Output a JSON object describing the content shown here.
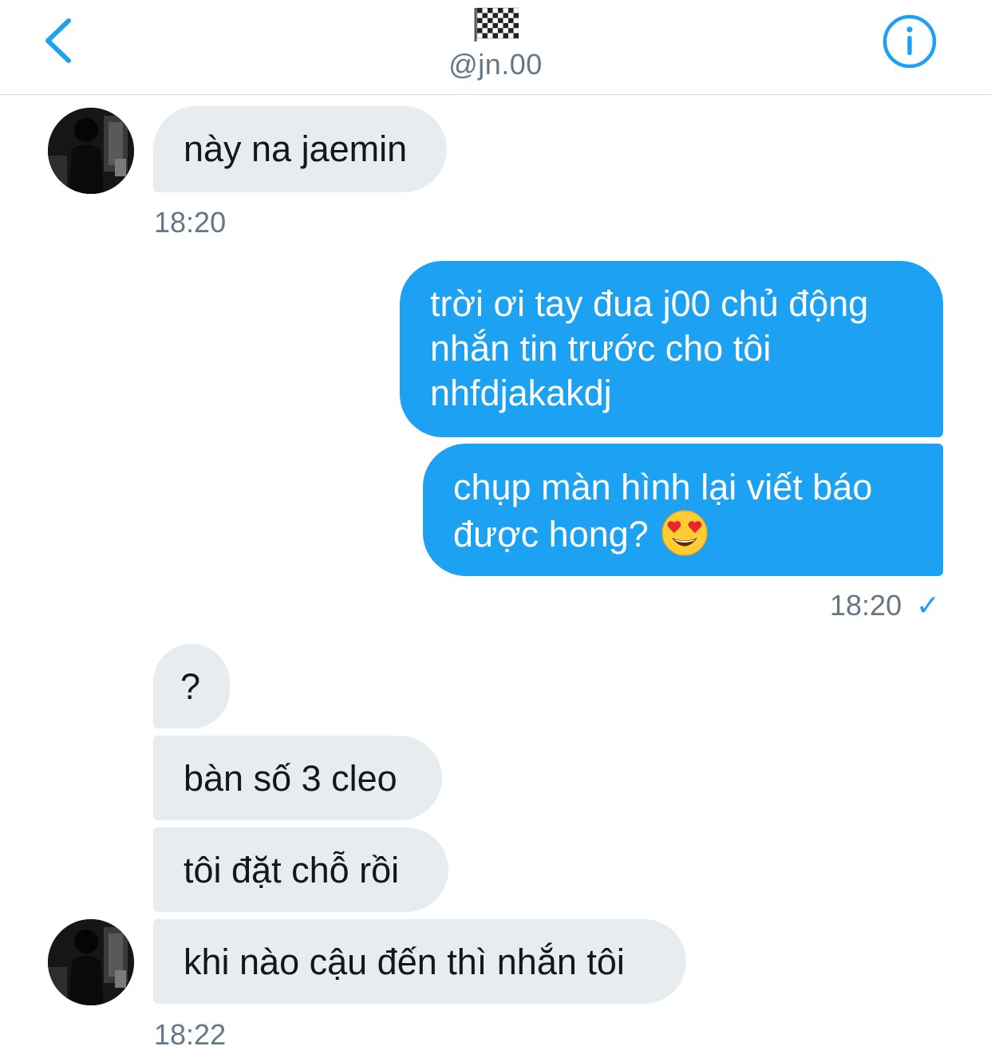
{
  "header": {
    "handle": "@jn.00",
    "back_icon": "chevron-left-icon",
    "info_icon": "info-circle-icon",
    "flag_icon": "checkered-flag-icon",
    "accent_color": "#1da1f2"
  },
  "messages": {
    "m1": "này na jaemin",
    "t1": "18:20",
    "m2": {
      "line1": "trời ơi tay đua j00 chủ động",
      "line2": "nhắn tin trước cho tôi",
      "line3": "nhfdjakakdj"
    },
    "m3": {
      "line1": "chụp màn hình lại viết báo",
      "line2": "được hong?",
      "emoji": "heart-eyes-emoji"
    },
    "t2": "18:20",
    "t2_status": "✓",
    "m4": "?",
    "m5": "bàn số 3 cleo",
    "m6": "tôi đặt chỗ rồi",
    "m7": "khi nào cậu đến thì nhắn tôi",
    "t3": "18:22"
  },
  "colors": {
    "incoming_bubble": "#e6ecf0",
    "outgoing_bubble": "#1da1f2",
    "timestamp": "#657786"
  }
}
